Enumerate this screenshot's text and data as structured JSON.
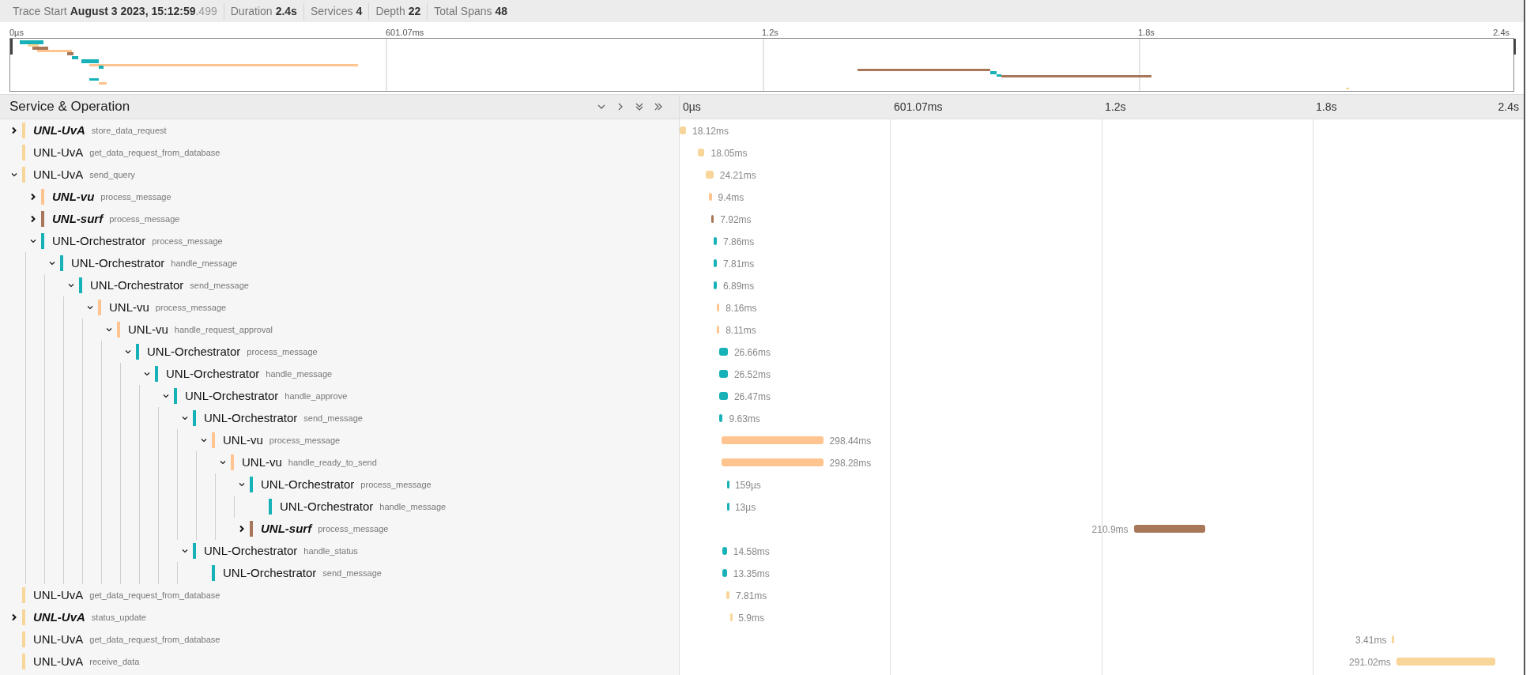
{
  "trace_header": [
    {
      "label": "Trace Start",
      "value": "August 3 2023, 15:12:59",
      "value_suffix": ".499"
    },
    {
      "label": "Duration",
      "value": "2.4s"
    },
    {
      "label": "Services",
      "value": "4"
    },
    {
      "label": "Depth",
      "value": "22"
    },
    {
      "label": "Total Spans",
      "value": "48"
    }
  ],
  "minimap": {
    "ticks": [
      "0µs",
      "601.07ms",
      "1.2s",
      "1.8s",
      "2.4s"
    ]
  },
  "span_table": {
    "column_title": "Service & Operation",
    "timeline_ticks": [
      "0µs",
      "601.07ms",
      "1.2s",
      "1.8s",
      "2.4s"
    ],
    "rows": [
      {
        "service": "UNL-UvA",
        "operation": "store_data_request",
        "duration": "18.12ms",
        "color": "#f8d598",
        "expanded": false
      },
      {
        "service": "UNL-UvA",
        "operation": "get_data_request_from_database",
        "duration": "18.05ms",
        "color": "#f8d598"
      },
      {
        "service": "UNL-UvA",
        "operation": "send_query",
        "duration": "24.21ms",
        "color": "#f8d598",
        "expanded": true,
        "children": [
          {
            "service": "UNL-vu",
            "operation": "process_message",
            "duration": "9.4ms",
            "color": "#ffc48f",
            "expanded": false
          },
          {
            "service": "UNL-surf",
            "operation": "process_message",
            "duration": "7.92ms",
            "color": "#a8775a",
            "expanded": false
          },
          {
            "service": "UNL-Orchestrator",
            "operation": "process_message",
            "duration": "7.86ms",
            "color": "#17b2b8",
            "expanded": true,
            "children": [
              {
                "service": "UNL-Orchestrator",
                "operation": "handle_message",
                "duration": "7.81ms",
                "color": "#17b2b8",
                "expanded": true,
                "children": [
                  {
                    "service": "UNL-Orchestrator",
                    "operation": "send_message",
                    "duration": "6.89ms",
                    "color": "#17b2b8",
                    "expanded": true,
                    "children": [
                      {
                        "service": "UNL-vu",
                        "operation": "process_message",
                        "duration": "8.16ms",
                        "color": "#ffc48f",
                        "expanded": true,
                        "children": [
                          {
                            "service": "UNL-vu",
                            "operation": "handle_request_approval",
                            "duration": "8.11ms",
                            "color": "#ffc48f",
                            "expanded": true,
                            "children": [
                              {
                                "service": "UNL-Orchestrator",
                                "operation": "process_message",
                                "duration": "26.66ms",
                                "color": "#17b2b8",
                                "expanded": true,
                                "children": [
                                  {
                                    "service": "UNL-Orchestrator",
                                    "operation": "handle_message",
                                    "duration": "26.52ms",
                                    "color": "#17b2b8",
                                    "expanded": true,
                                    "children": [
                                      {
                                        "service": "UNL-Orchestrator",
                                        "operation": "handle_approve",
                                        "duration": "26.47ms",
                                        "color": "#17b2b8",
                                        "expanded": true,
                                        "children": [
                                          {
                                            "service": "UNL-Orchestrator",
                                            "operation": "send_message",
                                            "duration": "9.63ms",
                                            "color": "#17b2b8",
                                            "expanded": true,
                                            "children": [
                                              {
                                                "service": "UNL-vu",
                                                "operation": "process_message",
                                                "duration": "298.44ms",
                                                "color": "#ffc48f",
                                                "expanded": true,
                                                "children": [
                                                  {
                                                    "service": "UNL-vu",
                                                    "operation": "handle_ready_to_send",
                                                    "duration": "298.28ms",
                                                    "color": "#ffc48f",
                                                    "expanded": true,
                                                    "children": [
                                                      {
                                                        "service": "UNL-Orchestrator",
                                                        "operation": "process_message",
                                                        "duration": "159µs",
                                                        "color": "#17b2b8",
                                                        "expanded": true,
                                                        "children": [
                                                          {
                                                            "service": "UNL-Orchestrator",
                                                            "operation": "handle_message",
                                                            "duration": "13µs",
                                                            "color": "#17b2b8"
                                                          }
                                                        ]
                                                      },
                                                      {
                                                        "service": "UNL-surf",
                                                        "operation": "process_message",
                                                        "duration": "210.9ms",
                                                        "color": "#a8775a",
                                                        "expanded": false
                                                      }
                                                    ]
                                                  }
                                                ]
                                              }
                                            ]
                                          },
                                          {
                                            "service": "UNL-Orchestrator",
                                            "operation": "handle_status",
                                            "duration": "14.58ms",
                                            "color": "#17b2b8",
                                            "expanded": true,
                                            "children": [
                                              {
                                                "service": "UNL-Orchestrator",
                                                "operation": "send_message",
                                                "duration": "13.35ms",
                                                "color": "#17b2b8"
                                              }
                                            ]
                                          }
                                        ]
                                      }
                                    ]
                                  }
                                ]
                              }
                            ]
                          }
                        ]
                      }
                    ]
                  }
                ]
              }
            ]
          }
        ]
      },
      {
        "service": "UNL-UvA",
        "operation": "get_data_request_from_database",
        "duration": "7.81ms",
        "color": "#f8d598"
      },
      {
        "service": "UNL-UvA",
        "operation": "status_update",
        "duration": "5.9ms",
        "color": "#f8d598",
        "expanded": false
      },
      {
        "service": "UNL-UvA",
        "operation": "get_data_request_from_database",
        "duration": "3.41ms",
        "color": "#f8d598"
      },
      {
        "service": "UNL-UvA",
        "operation": "receive_data",
        "duration": "291.02ms",
        "color": "#f8d598"
      }
    ]
  }
}
